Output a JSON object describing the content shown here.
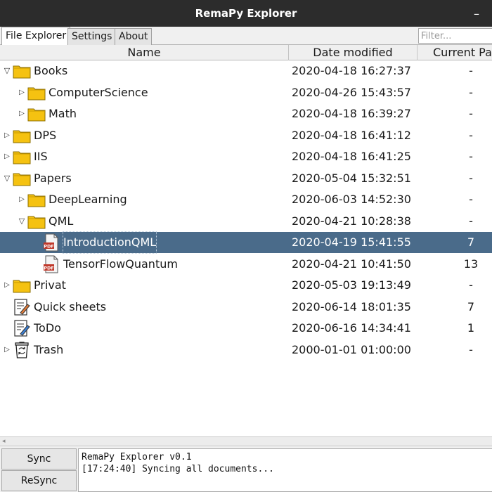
{
  "window": {
    "title": "RemaPy Explorer",
    "minimize_glyph": "–"
  },
  "tabs": [
    {
      "label": "File Explorer",
      "active": true
    },
    {
      "label": "Settings",
      "active": false
    },
    {
      "label": "About",
      "active": false
    }
  ],
  "filter": {
    "placeholder": "Filter...",
    "value": ""
  },
  "columns": {
    "name": "Name",
    "date": "Date modified",
    "page": "Current Pa"
  },
  "rows": [
    {
      "name": "Books",
      "type": "folder",
      "level": 0,
      "expander": "expanded",
      "date": "2020-04-18 16:27:37",
      "page": "-"
    },
    {
      "name": "ComputerScience",
      "type": "folder",
      "level": 1,
      "expander": "collapsed",
      "date": "2020-04-26 15:43:57",
      "page": "-"
    },
    {
      "name": "Math",
      "type": "folder",
      "level": 1,
      "expander": "collapsed",
      "date": "2020-04-18 16:39:27",
      "page": "-"
    },
    {
      "name": "DPS",
      "type": "folder",
      "level": 0,
      "expander": "collapsed",
      "date": "2020-04-18 16:41:12",
      "page": "-"
    },
    {
      "name": "IIS",
      "type": "folder",
      "level": 0,
      "expander": "collapsed",
      "date": "2020-04-18 16:41:25",
      "page": "-"
    },
    {
      "name": "Papers",
      "type": "folder",
      "level": 0,
      "expander": "expanded",
      "date": "2020-05-04 15:32:51",
      "page": "-"
    },
    {
      "name": "DeepLearning",
      "type": "folder",
      "level": 1,
      "expander": "collapsed",
      "date": "2020-06-03 14:52:30",
      "page": "-"
    },
    {
      "name": "QML",
      "type": "folder",
      "level": 1,
      "expander": "expanded",
      "date": "2020-04-21 10:28:38",
      "page": "-"
    },
    {
      "name": "IntroductionQML",
      "type": "pdf",
      "level": 2,
      "expander": "none",
      "date": "2020-04-19 15:41:55",
      "page": "7",
      "selected": true
    },
    {
      "name": "TensorFlowQuantum",
      "type": "pdf",
      "level": 2,
      "expander": "none",
      "date": "2020-04-21 10:41:50",
      "page": "13"
    },
    {
      "name": "Privat",
      "type": "folder",
      "level": 0,
      "expander": "collapsed",
      "date": "2020-05-03 19:13:49",
      "page": "-"
    },
    {
      "name": "Quick sheets",
      "type": "notebook",
      "level": 0,
      "expander": "none",
      "date": "2020-06-14 18:01:35",
      "page": "7"
    },
    {
      "name": "ToDo",
      "type": "notebook-blue",
      "level": 0,
      "expander": "none",
      "date": "2020-06-16 14:34:41",
      "page": "1"
    },
    {
      "name": "Trash",
      "type": "trash",
      "level": 0,
      "expander": "collapsed",
      "date": "2000-01-01 01:00:00",
      "page": "-"
    }
  ],
  "buttons": {
    "sync": "Sync",
    "resync": "ReSync"
  },
  "log": {
    "line1": "RemaPy Explorer v0.1",
    "line2": "[17:24:40] Syncing all documents..."
  },
  "colors": {
    "selection": "#4a6b8a",
    "folder": "#f5c211",
    "titlebar": "#2c2c2c"
  }
}
